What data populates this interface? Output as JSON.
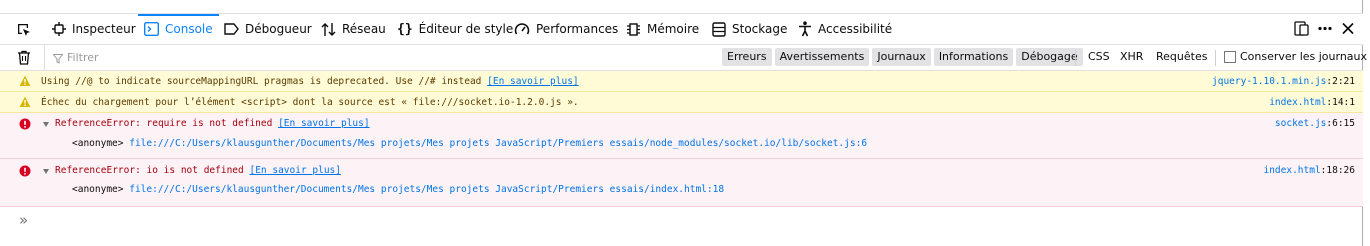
{
  "toolbar": {
    "tabs": [
      {
        "label": "Inspecteur",
        "icon": "inspector-icon"
      },
      {
        "label": "Console",
        "icon": "console-icon"
      },
      {
        "label": "Débogueur",
        "icon": "debugger-icon"
      },
      {
        "label": "Réseau",
        "icon": "network-icon"
      },
      {
        "label": "Éditeur de style",
        "icon": "style-editor-icon"
      },
      {
        "label": "Performances",
        "icon": "performance-icon"
      },
      {
        "label": "Mémoire",
        "icon": "memory-icon"
      },
      {
        "label": "Stockage",
        "icon": "storage-icon"
      },
      {
        "label": "Accessibilité",
        "icon": "accessibility-icon"
      }
    ],
    "selected_tab": "Console"
  },
  "filter": {
    "placeholder": "Filtrer",
    "level_chips": [
      "Erreurs",
      "Avertissements",
      "Journaux",
      "Informations",
      "Débogage"
    ],
    "type_filters": [
      "CSS",
      "XHR",
      "Requêtes"
    ],
    "persist_label": "Conserver les journaux"
  },
  "messages": [
    {
      "type": "warning",
      "text": "Using //@ to indicate sourceMappingURL pragmas is deprecated. Use //# instead",
      "link": "[En savoir plus]",
      "source_file": "jquery-1.10.1.min.js",
      "source_pos": ":2:21"
    },
    {
      "type": "warning",
      "text": "Échec du chargement pour l’élément <script> dont la source est « file:///socket.io-1.2.0.js ».",
      "source_file": "index.html",
      "source_pos": ":14:1"
    },
    {
      "type": "error",
      "text": "ReferenceError: require is not defined",
      "link": "[En savoir plus]",
      "source_file": "socket.js",
      "source_pos": ":6:15",
      "trace_fn": "<anonyme>",
      "trace_path": "file:///C:/Users/klausgunther/Documents/Mes projets/Mes projets JavaScript/Premiers essais/node_modules/socket.io/lib/socket.js",
      "trace_line": ":6"
    },
    {
      "type": "error",
      "text": "ReferenceError: io is not defined",
      "link": "[En savoir plus]",
      "source_file": "index.html",
      "source_pos": ":18:26",
      "trace_fn": "<anonyme>",
      "trace_path": "file:///C:/Users/klausgunther/Documents/Mes projets/Mes projets JavaScript/Premiers essais/index.html",
      "trace_line": ":18"
    }
  ],
  "prompt": "»",
  "colors": {
    "accent": "#0a84ff",
    "warning_bg": "#fffbd6",
    "error_bg": "#fdf2f5",
    "link": "#0074e8"
  }
}
